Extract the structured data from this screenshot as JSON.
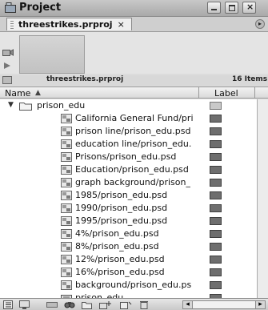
{
  "window": {
    "title": "Project"
  },
  "tab": {
    "label": "threestrikes.prproj",
    "close_glyph": "×"
  },
  "info": {
    "project_name": "threestrikes.prproj",
    "items_count": "16 Items"
  },
  "columns": {
    "name": "Name",
    "label": "Label"
  },
  "bin": {
    "name": "prison_edu"
  },
  "items": [
    {
      "name": "California General Fund/pri",
      "icon": "psd-file-icon"
    },
    {
      "name": "prison line/prison_edu.psd",
      "icon": "psd-file-icon"
    },
    {
      "name": "education line/prison_edu.",
      "icon": "psd-file-icon"
    },
    {
      "name": "Prisons/prison_edu.psd",
      "icon": "psd-file-icon"
    },
    {
      "name": "Education/prison_edu.psd",
      "icon": "psd-file-icon"
    },
    {
      "name": "graph background/prison_",
      "icon": "psd-file-icon"
    },
    {
      "name": "1985/prison_edu.psd",
      "icon": "psd-file-icon"
    },
    {
      "name": "1990/prison_edu.psd",
      "icon": "psd-file-icon"
    },
    {
      "name": "1995/prison_edu.psd",
      "icon": "psd-file-icon"
    },
    {
      "name": "4%/prison_edu.psd",
      "icon": "psd-file-icon"
    },
    {
      "name": "8%/prison_edu.psd",
      "icon": "psd-file-icon"
    },
    {
      "name": "12%/prison_edu.psd",
      "icon": "psd-file-icon"
    },
    {
      "name": "16%/prison_edu.psd",
      "icon": "psd-file-icon"
    },
    {
      "name": "background/prison_edu.ps",
      "icon": "psd-file-icon"
    },
    {
      "name": "prison_edu",
      "icon": "sequence-icon"
    }
  ],
  "colors": {
    "label_swatch": "#6e6e6e",
    "bin_label_swatch": "#c9c9c9"
  }
}
